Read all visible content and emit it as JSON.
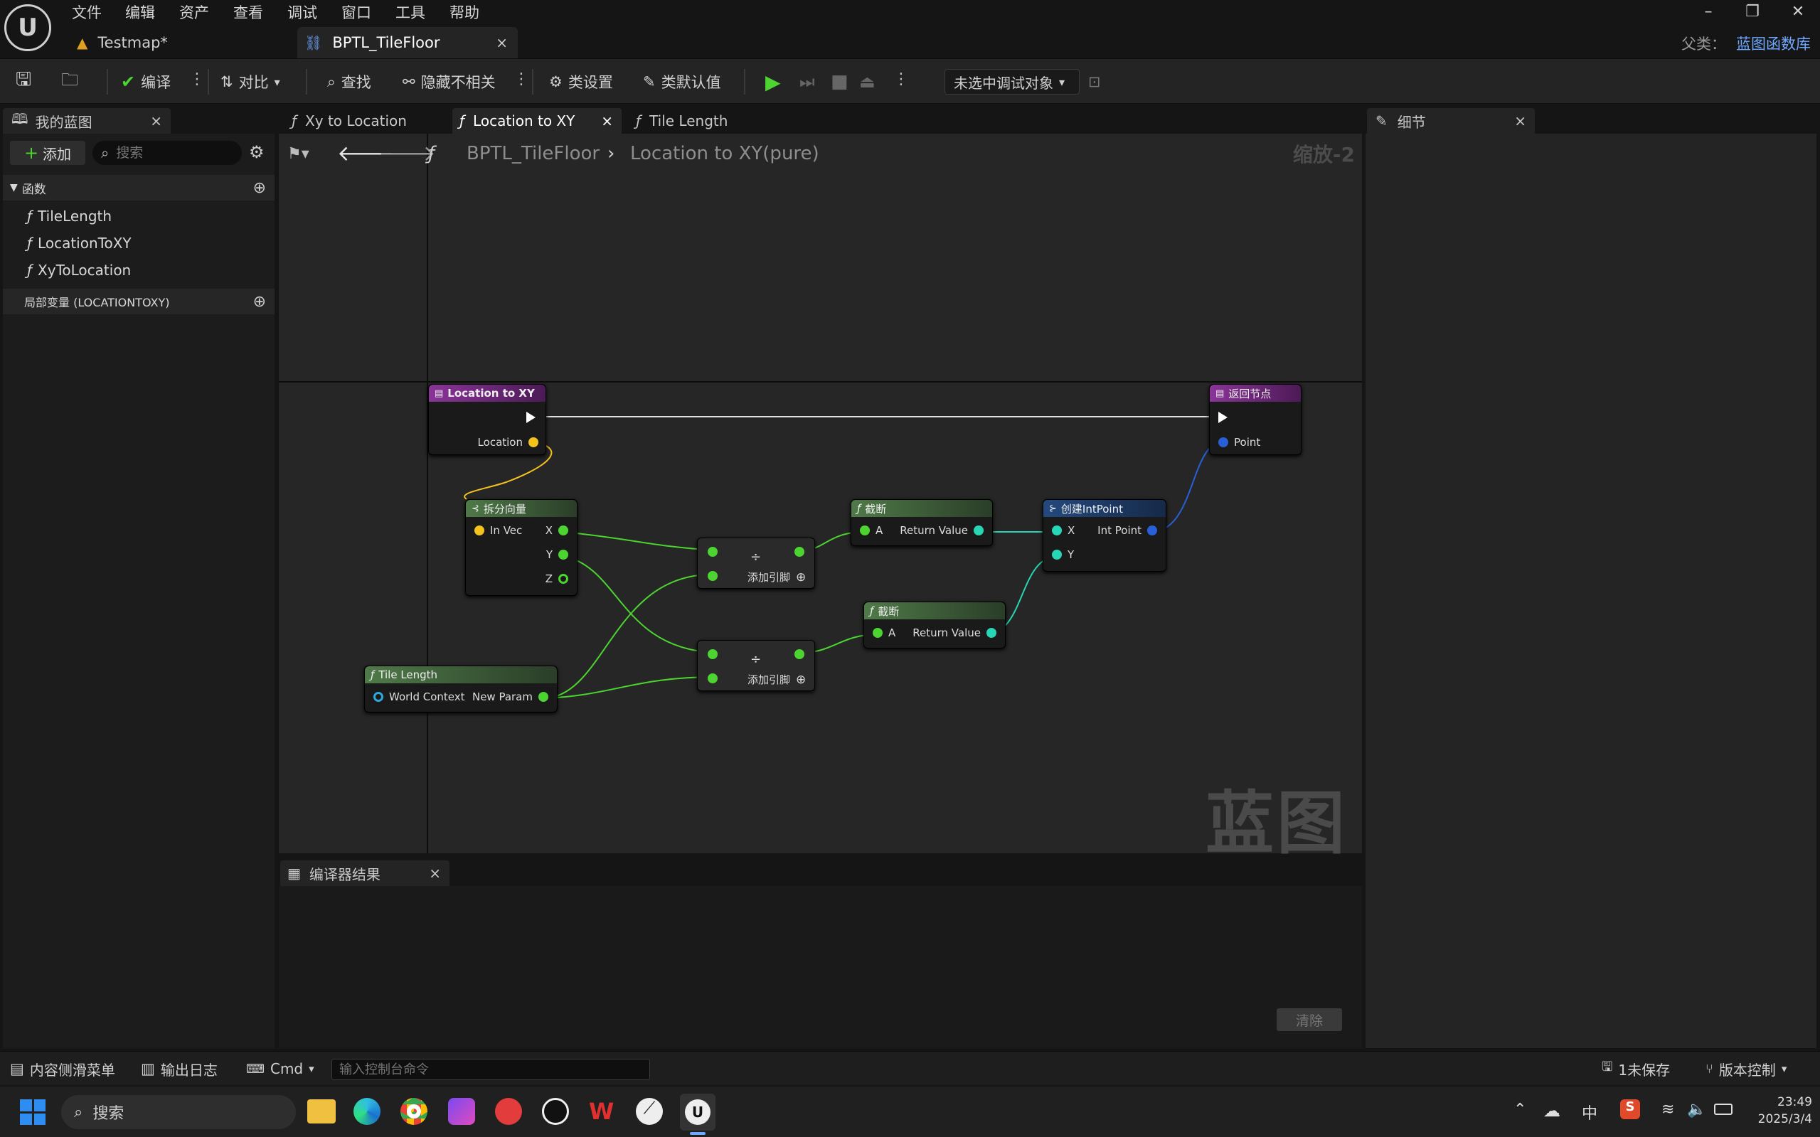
{
  "menu": [
    "文件",
    "编辑",
    "资产",
    "查看",
    "调试",
    "窗口",
    "工具",
    "帮助"
  ],
  "tabs": {
    "map": "Testmap*",
    "bp": "BPTL_TileFloor"
  },
  "parent": {
    "label": "父类：",
    "value": "蓝图函数库"
  },
  "toolbar": {
    "compile": "编译",
    "diff": "对比",
    "find": "查找",
    "hide": "隐藏不相关",
    "class_settings": "类设置",
    "class_defaults": "类默认值",
    "debug_target": "未选中调试对象"
  },
  "left": {
    "tab": "我的蓝图",
    "add": "添加",
    "search_placeholder": "搜索",
    "functions_header": "函数",
    "functions": [
      "TileLength",
      "LocationToXY",
      "XyToLocation"
    ],
    "locals_header": "局部变量 (LOCATIONTOXY)"
  },
  "graph_tabs": [
    "Xy to Location",
    "Location to XY",
    "Tile Length"
  ],
  "breadcrumb": {
    "root": "BPTL_TileFloor",
    "current": "Location to XY(pure)",
    "zoom": "缩放-2"
  },
  "watermark": "蓝图",
  "nodes": {
    "entry": {
      "title": "Location to XY",
      "pin": "Location"
    },
    "ret": {
      "title": "返回节点",
      "pin": "Point"
    },
    "break": {
      "title": "拆分向量",
      "in": "In Vec",
      "x": "X",
      "y": "Y",
      "z": "Z"
    },
    "div": {
      "symbol": "÷",
      "add": "添加引脚"
    },
    "trunc": {
      "title": "截断",
      "a": "A",
      "rv": "Return Value"
    },
    "make": {
      "title": "创建IntPoint",
      "x": "X",
      "y": "Y",
      "out": "Int Point"
    },
    "tile": {
      "title": "Tile Length",
      "wc": "World Context",
      "np": "New Param"
    }
  },
  "details": {
    "tab": "细节"
  },
  "compiler": {
    "tab": "编译器结果",
    "clear": "清除"
  },
  "status": {
    "drawer": "内容侧滑菜单",
    "log": "输出日志",
    "cmd": "Cmd",
    "cmd_placeholder": "输入控制台命令",
    "unsaved": "1未保存",
    "vc": "版本控制"
  },
  "taskbar": {
    "search": "搜索",
    "ime": "中",
    "time": "23:49",
    "date": "2025/3/4"
  },
  "colors": {
    "function_header": "#3f6b3a",
    "entry_header": "#7a2a8a",
    "make_header": "#1f3c6c",
    "accent": "#6fa8ff"
  }
}
